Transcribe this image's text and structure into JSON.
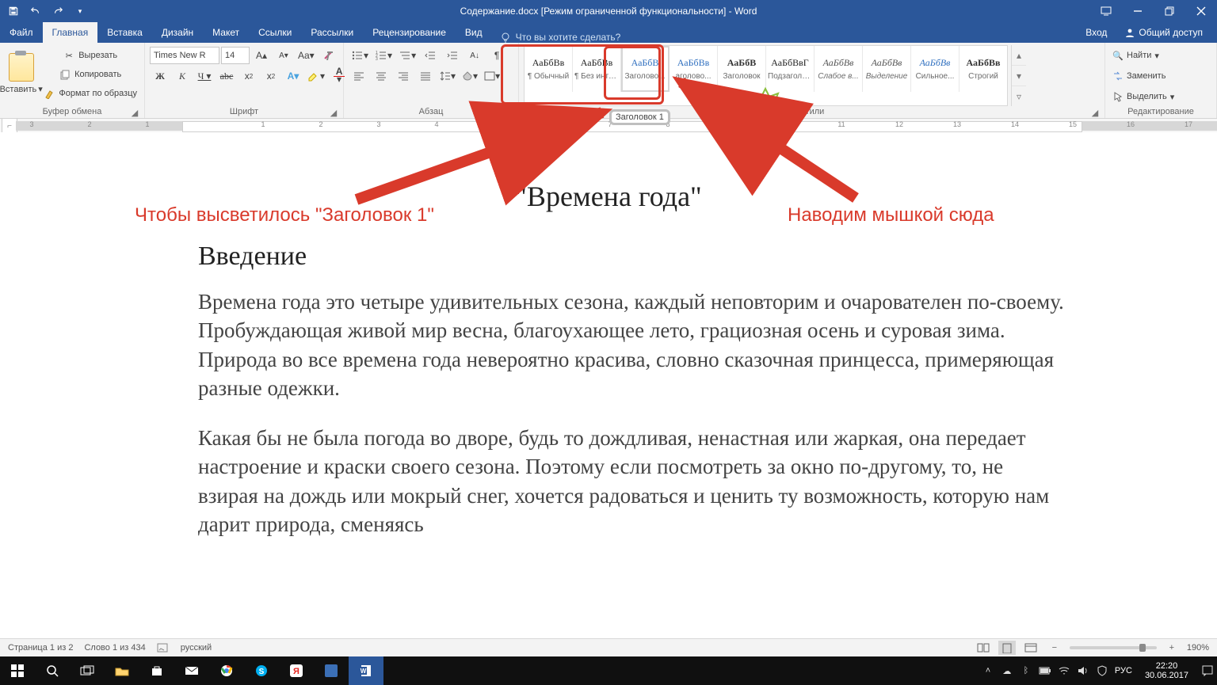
{
  "titlebar": {
    "title": "Содержание.docx [Режим ограниченной функциональности] - Word"
  },
  "tabs": {
    "file": "Файл",
    "home": "Главная",
    "insert": "Вставка",
    "design": "Дизайн",
    "layout": "Макет",
    "refs": "Ссылки",
    "mail": "Рассылки",
    "review": "Рецензирование",
    "view": "Вид",
    "tellme": "Что вы хотите сделать?",
    "signin": "Вход",
    "share": "Общий доступ"
  },
  "ribbon": {
    "clipboard": {
      "label": "Буфер обмена",
      "paste": "Вставить",
      "cut": "Вырезать",
      "copy": "Копировать",
      "painter": "Формат по образцу"
    },
    "font": {
      "label": "Шрифт",
      "name": "Times New R",
      "size": "14"
    },
    "paragraph": {
      "label": "Абзац"
    },
    "styles": {
      "label": "Стили",
      "items": [
        {
          "preview": "АаБбВв",
          "caption": "¶ Обычный",
          "cls": ""
        },
        {
          "preview": "АаБбВв",
          "caption": "¶ Без инте...",
          "cls": ""
        },
        {
          "preview": "АаБбВ",
          "caption": "Заголово...",
          "cls": "blue outlined"
        },
        {
          "preview": "АаБбВв",
          "caption": "аголово...",
          "cls": "blue"
        },
        {
          "preview": "АаБбВ",
          "caption": "Заголовок",
          "cls": "darkbold"
        },
        {
          "preview": "АаБбВвГ",
          "caption": "Подзаголо...",
          "cls": ""
        },
        {
          "preview": "АаБбВв",
          "caption": "Слабое в...",
          "cls": "italic"
        },
        {
          "preview": "АаБбВв",
          "caption": "Выделение",
          "cls": "italic"
        },
        {
          "preview": "АаБбВв",
          "caption": "Сильное...",
          "cls": "blueit"
        },
        {
          "preview": "АаБбВв",
          "caption": "Строгий",
          "cls": "darkbold"
        }
      ]
    },
    "editing": {
      "label": "Редактирование",
      "find": "Найти",
      "replace": "Заменить",
      "select": "Выделить"
    }
  },
  "tooltip": {
    "heading1": "Заголовок 1"
  },
  "annotation": {
    "left": "Чтобы высветилось \"Заголовок 1\"",
    "right": "Наводим мышкой сюда"
  },
  "document": {
    "title": "\"Времена года\"",
    "h1": "Введение",
    "p1": "Времена года это четыре удивительных сезона, каждый неповторим и очарователен по-своему. Пробуждающая живой мир весна, благоухающее лето, грациозная осень и суровая зима. Природа во все времена года невероятно красива, словно сказочная принцесса, примеряющая разные одежки.",
    "p2": "Какая бы не была погода во дворе, будь то дождливая, ненастная или жаркая, она передает настроение и краски своего сезона. Поэтому если посмотреть за окно по-другому, то, не взирая на дождь или мокрый снег, хочется радоваться и ценить ту возможность, которую нам дарит природа, сменяясь"
  },
  "statusbar": {
    "page": "Страница 1 из 2",
    "words": "Слово 1 из 434",
    "lang": "русский",
    "zoom": "190%"
  },
  "taskbar": {
    "lang": "РУС",
    "time": "22:20",
    "date": "30.06.2017"
  }
}
